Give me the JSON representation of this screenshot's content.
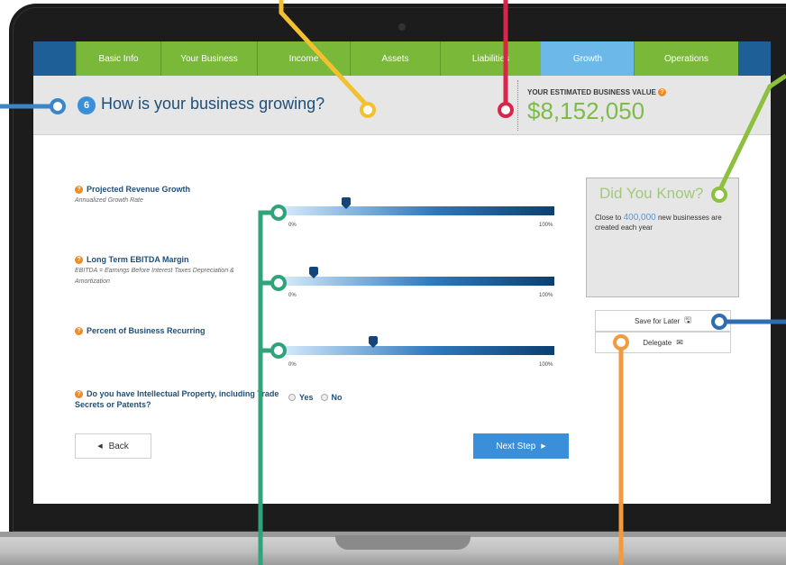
{
  "nav": {
    "tabs": [
      {
        "label": "Basic Info"
      },
      {
        "label": "Your Business"
      },
      {
        "label": "Income"
      },
      {
        "label": "Assets"
      },
      {
        "label": "Liabilities"
      },
      {
        "label": "Growth"
      },
      {
        "label": "Operations"
      }
    ],
    "active_tab": "Growth"
  },
  "header": {
    "step_number": "6",
    "title": "How is your business growing?",
    "value_label": "YOUR ESTIMATED BUSINESS VALUE",
    "value_amount": "$8,152,050"
  },
  "questions": [
    {
      "label": "Projected Revenue Growth",
      "sub": "Annualized Growth Rate",
      "min_label": "0%",
      "max_label": "100%",
      "value_fraction": 0.23
    },
    {
      "label": "Long Term EBITDA Margin",
      "sub": "EBITDA = Earnings Before Interest Taxes Depreciation & Amortization",
      "min_label": "0%",
      "max_label": "100%",
      "value_fraction": 0.11
    },
    {
      "label": "Percent of Business Recurring",
      "sub": "",
      "min_label": "0%",
      "max_label": "100%",
      "value_fraction": 0.33
    },
    {
      "label_line1": "Do you have Intellectual Property, including Trade",
      "label_line2": "Secrets or Patents?",
      "options": [
        "Yes",
        "No"
      ]
    }
  ],
  "buttons": {
    "back": "Back",
    "next": "Next Step",
    "save": "Save for Later",
    "delegate": "Delegate"
  },
  "did_you_know": {
    "title": "Did You Know?",
    "text_before": "Close to",
    "highlight": "400,000",
    "text_after": "new businesses are created each year"
  },
  "icons": {
    "help": "question-circle-icon",
    "back": "caret-left-icon",
    "next": "caret-right-icon",
    "save": "floppy-disk-icon",
    "delegate": "envelope-icon"
  },
  "colors": {
    "nav_bg": "#1d5f96",
    "tab_green": "#7ab83a",
    "tab_active": "#6cb8e8",
    "value_green": "#7dbb4a",
    "callout_blue": "#3a86c8",
    "callout_yellow": "#f2c12e",
    "callout_red": "#d7264a",
    "callout_green": "#8dc03f",
    "callout_teal": "#2fa37a",
    "callout_navy": "#2f6db0",
    "callout_orange": "#f29a3f"
  }
}
